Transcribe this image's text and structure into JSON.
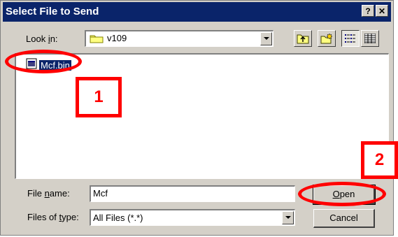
{
  "window": {
    "title": "Select File to Send",
    "help_label": "?",
    "close_label": "✕"
  },
  "look_in": {
    "label_pre": "Look ",
    "label_accel": "i",
    "label_post": "n:",
    "value": "v109"
  },
  "toolbar": {
    "icons": [
      "up-one-level-icon",
      "create-new-folder-icon",
      "list-view-icon",
      "details-view-icon"
    ]
  },
  "files": [
    {
      "name": "Mcf.bin",
      "selected": true
    }
  ],
  "file_name": {
    "label_pre": "File ",
    "label_accel": "n",
    "label_post": "ame:",
    "value": "Mcf"
  },
  "file_type": {
    "label_pre": "Files of ",
    "label_accel": "t",
    "label_post": "ype:",
    "value": "All Files (*.*)"
  },
  "buttons": {
    "open_accel": "O",
    "open_rest": "pen",
    "cancel": "Cancel"
  },
  "annotations": {
    "callout_1": "1",
    "callout_2": "2",
    "color": "#ff0000"
  }
}
